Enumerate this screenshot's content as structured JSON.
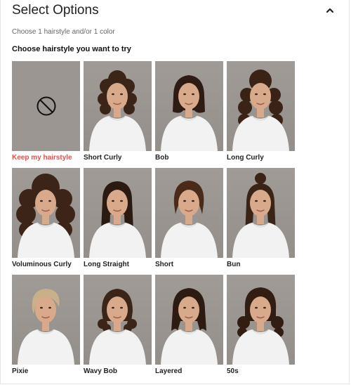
{
  "header": {
    "title": "Select Options"
  },
  "subtitle": "Choose 1 hairstyle and/or 1 color",
  "section_label": "Choose hairstyle you want to try",
  "options": [
    {
      "label": "Keep my hairstyle",
      "selected": true,
      "icon": "no-change-icon"
    },
    {
      "label": "Short Curly",
      "style": "short-curly",
      "hair": "#3b2418"
    },
    {
      "label": "Bob",
      "style": "bob",
      "hair": "#2e1c14"
    },
    {
      "label": "Long Curly",
      "style": "long-curly",
      "hair": "#3a2316"
    },
    {
      "label": "Voluminous Curly",
      "style": "voluminous",
      "hair": "#3d2418"
    },
    {
      "label": "Long Straight",
      "style": "long-straight",
      "hair": "#2a1a12"
    },
    {
      "label": "Short",
      "style": "short",
      "hair": "#4a2a18"
    },
    {
      "label": "Bun",
      "style": "bun",
      "hair": "#3a2418"
    },
    {
      "label": "Pixie",
      "style": "pixie",
      "hair": "#c9b08a"
    },
    {
      "label": "Wavy Bob",
      "style": "wavy-bob",
      "hair": "#3b2418"
    },
    {
      "label": "Layered",
      "style": "layered",
      "hair": "#2c1b13"
    },
    {
      "label": "50s",
      "style": "fifties",
      "hair": "#321d13"
    }
  ],
  "colors": {
    "accent": "#d9534f",
    "skin": "#d8a98a",
    "shirt": "#f2f2f2"
  }
}
